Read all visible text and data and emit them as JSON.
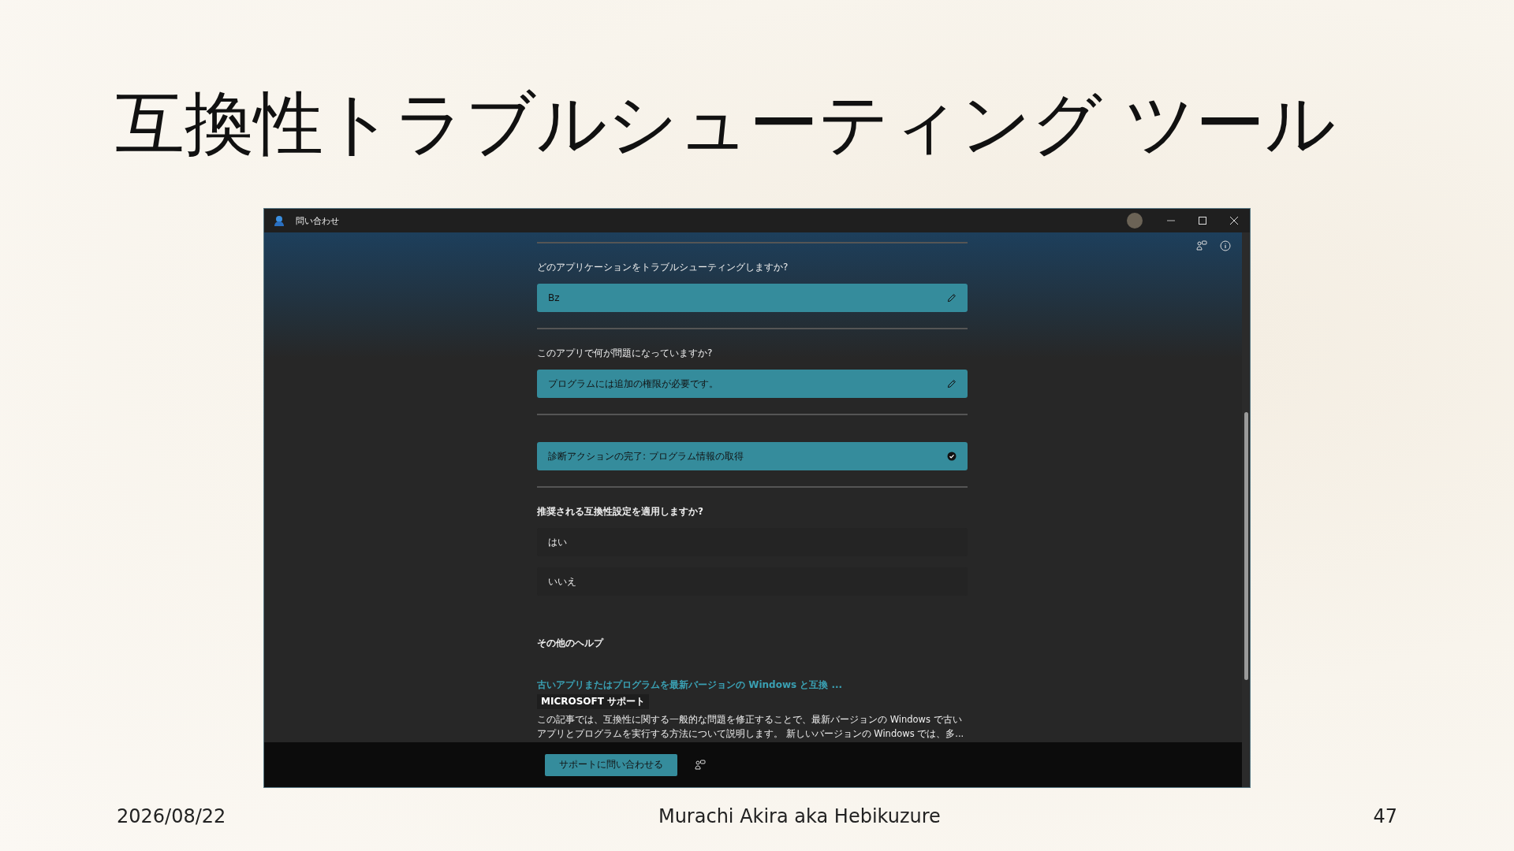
{
  "slide": {
    "title": "互換性トラブルシューティング ツール",
    "date": "2026/08/22",
    "author": "Murachi Akira aka Hebikuzure",
    "page": "47"
  },
  "window": {
    "title": "問い合わせ"
  },
  "sections": [
    {
      "kind": "answered",
      "question": "どのアプリケーションをトラブルシューティングしますか?",
      "answer": "Bz"
    },
    {
      "kind": "answered",
      "question": "このアプリで何が問題になっていますか?",
      "answer": "プログラムには追加の権限が必要です。"
    },
    {
      "kind": "status",
      "answer": "診断アクションの完了: プログラム情報の取得"
    },
    {
      "kind": "choice",
      "question": "推奨される互換性設定を適用しますか?",
      "options": [
        "はい",
        "いいえ"
      ]
    }
  ],
  "help": {
    "heading": "その他のヘルプ",
    "link": "古いアプリまたはプログラムを最新バージョンの Windows と互換 ...",
    "source": "MICROSOFT サポート",
    "description": "この記事では、互換性に関する一般的な問題を修正することで、最新バージョンの Windows で古いアプリとプログラムを実行する方法について説明します。 新しいバージョンの Windows では、多..."
  },
  "footer": {
    "button": "サポートに問い合わせる"
  }
}
